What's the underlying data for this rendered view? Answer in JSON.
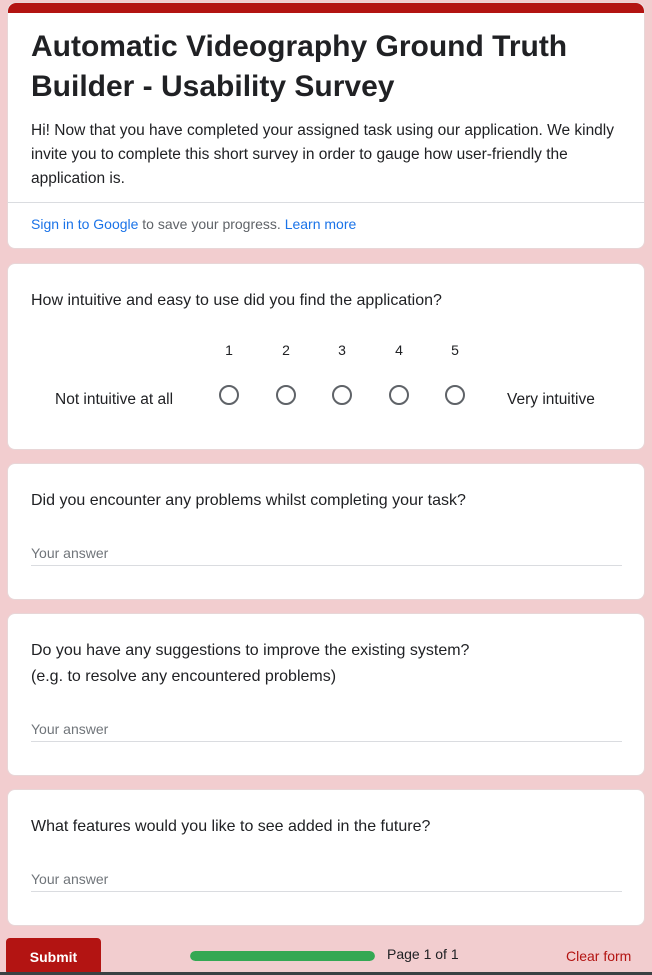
{
  "form": {
    "title": "Automatic Videography Ground Truth Builder - Usability Survey",
    "description": "Hi! Now that you have completed your assigned task using our application. We kindly invite you to complete this short survey in order to gauge how user-friendly the application is.",
    "signin_link": "Sign in to Google",
    "signin_text": " to save your progress. ",
    "learn_more": "Learn more"
  },
  "questions": [
    {
      "title": "How intuitive and easy to use did you find the application?",
      "type": "linear-scale",
      "scale": [
        "1",
        "2",
        "3",
        "4",
        "5"
      ],
      "low_label": "Not intuitive at all",
      "high_label": "Very intuitive"
    },
    {
      "title": "Did you encounter any problems whilst completing your task?",
      "type": "text",
      "placeholder": "Your answer"
    },
    {
      "title_line1": "Do you have any suggestions to improve the existing system?",
      "title_line2": "(e.g. to resolve any encountered problems)",
      "type": "text",
      "placeholder": "Your answer"
    },
    {
      "title": "What features would you like to see added in the future?",
      "type": "text",
      "placeholder": "Your answer"
    }
  ],
  "footer": {
    "submit_label": "Submit",
    "page_indicator": "Page 1 of 1",
    "progress": 1.0,
    "clear_label": "Clear form"
  },
  "colors": {
    "accent": "#b31412",
    "background": "#f2cdcf",
    "link": "#1a73e8",
    "progress": "#34a853"
  }
}
